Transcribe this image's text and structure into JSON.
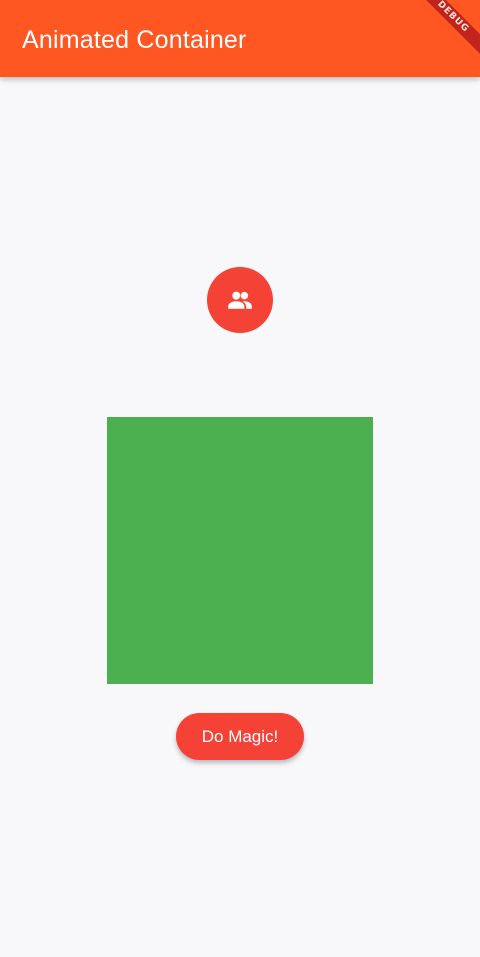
{
  "app_bar": {
    "title": "Animated Container",
    "color": "#FF5722"
  },
  "debug_banner": {
    "label": "DEBUG",
    "color": "#B71C1C"
  },
  "main": {
    "icon": {
      "name": "people-icon",
      "background": "#F44336"
    },
    "animated_box": {
      "color": "#4CAF50"
    },
    "button": {
      "label": "Do Magic!",
      "color": "#F44336"
    }
  }
}
